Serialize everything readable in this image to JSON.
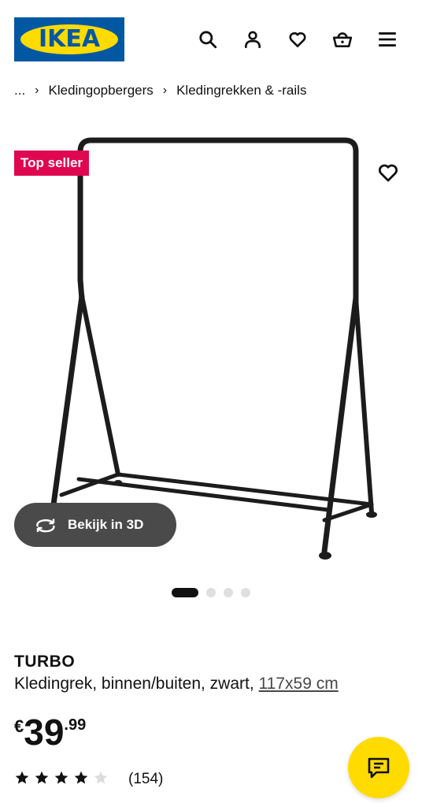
{
  "header": {
    "logo_text": "IKEA",
    "icons": [
      "search-icon",
      "account-icon",
      "heart-icon",
      "basket-icon",
      "menu-icon"
    ]
  },
  "breadcrumb": {
    "ellipsis": "...",
    "items": [
      "Kledingopbergers",
      "Kledingrekken & -rails"
    ]
  },
  "gallery": {
    "badge": "Top seller",
    "view_3d_label": "Bekijk in 3D",
    "slides": 4,
    "active_slide": 1
  },
  "product": {
    "name": "TURBO",
    "description": "Kledingrek, binnen/buiten, zwart,",
    "size_link": "117x59 cm",
    "price": {
      "currency": "€",
      "integer": "39",
      "decimal": ".99"
    },
    "rating": {
      "stars": 4,
      "max": 5,
      "count": "(154)"
    }
  },
  "colors": {
    "ikea_blue": "#0058a3",
    "ikea_yellow": "#ffdb00",
    "badge_red": "#e00751",
    "button_dark": "#4a4a4a"
  }
}
